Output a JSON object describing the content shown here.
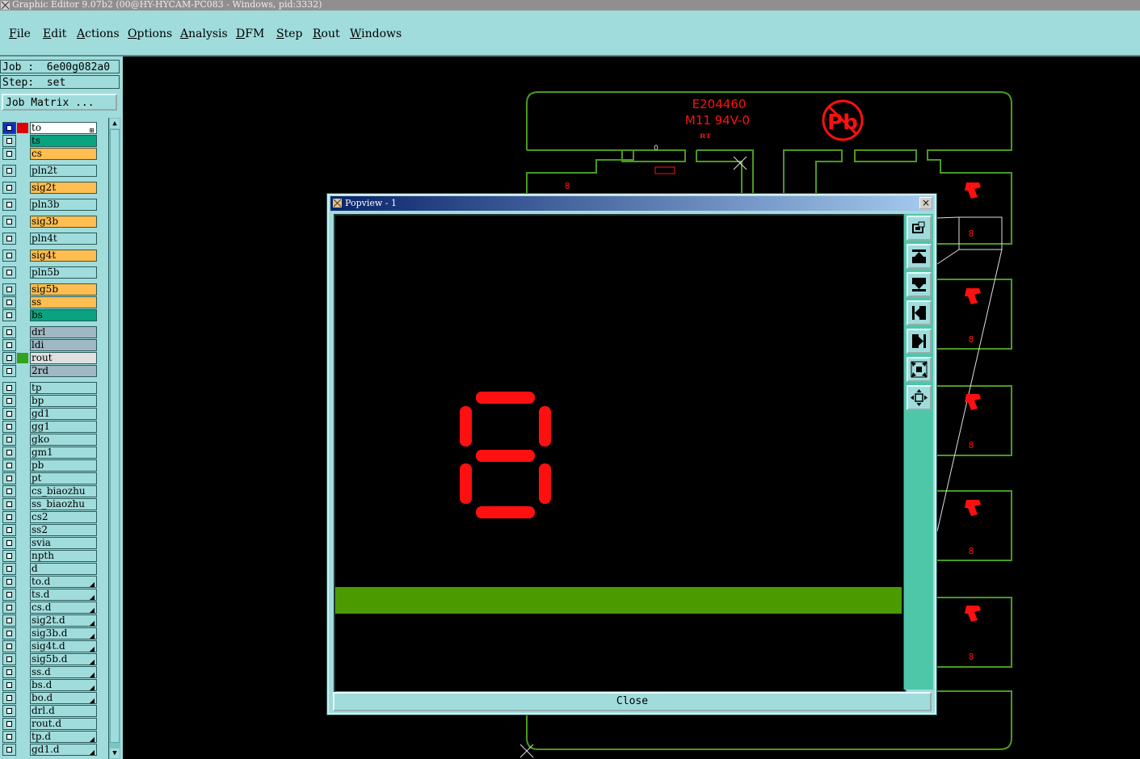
{
  "window": {
    "title": "Graphic Editor 9.07b2 (00@HY-HYCAM-PC083 - Windows, pid:3332)"
  },
  "menu": {
    "items": [
      "File",
      "Edit",
      "Actions",
      "Options",
      "Analysis",
      "DFM",
      "Step",
      "Rout",
      "Windows"
    ]
  },
  "job": {
    "job_label": "Job :  6e00g082a0",
    "step_label": "Step:  set",
    "matrix_button": "Job Matrix ..."
  },
  "layers": [
    {
      "name": "to",
      "color": "#ffffff",
      "swatch": "#e00000",
      "icon": "plus-icon"
    },
    {
      "name": "ts",
      "color": "#0aa37f",
      "swatch": ""
    },
    {
      "name": "cs",
      "color": "#ffbe4f",
      "swatch": ""
    },
    {
      "name": "pln2t",
      "color": "#a0dcdc",
      "swatch": ""
    },
    {
      "name": "sig2t",
      "color": "#ffbe4f",
      "swatch": ""
    },
    {
      "name": "pln3b",
      "color": "#a0dcdc",
      "swatch": ""
    },
    {
      "name": "sig3b",
      "color": "#ffbe4f",
      "swatch": ""
    },
    {
      "name": "pln4t",
      "color": "#a0dcdc",
      "swatch": ""
    },
    {
      "name": "sig4t",
      "color": "#ffbe4f",
      "swatch": ""
    },
    {
      "name": "pln5b",
      "color": "#a0dcdc",
      "swatch": ""
    },
    {
      "name": "sig5b",
      "color": "#ffbe4f",
      "swatch": ""
    },
    {
      "name": "ss",
      "color": "#ffbe4f",
      "swatch": ""
    },
    {
      "name": "bs",
      "color": "#0aa37f",
      "swatch": ""
    },
    {
      "name": "drl",
      "color": "#9fb8c4",
      "swatch": ""
    },
    {
      "name": "ldi",
      "color": "#9fb8c4",
      "swatch": ""
    },
    {
      "name": "rout",
      "color": "#e0e0e0",
      "swatch": "#33a31d"
    },
    {
      "name": "2rd",
      "color": "#9fb8c4",
      "swatch": ""
    },
    {
      "name": "tp",
      "color": "#a0dcdc",
      "swatch": ""
    },
    {
      "name": "bp",
      "color": "#a0dcdc",
      "swatch": ""
    },
    {
      "name": "gd1",
      "color": "#a0dcdc",
      "swatch": ""
    },
    {
      "name": "gg1",
      "color": "#a0dcdc",
      "swatch": ""
    },
    {
      "name": "gko",
      "color": "#a0dcdc",
      "swatch": ""
    },
    {
      "name": "gm1",
      "color": "#a0dcdc",
      "swatch": ""
    },
    {
      "name": "pb",
      "color": "#a0dcdc",
      "swatch": ""
    },
    {
      "name": "pt",
      "color": "#a0dcdc",
      "swatch": ""
    },
    {
      "name": "cs_biaozhu",
      "color": "#a0dcdc",
      "swatch": ""
    },
    {
      "name": "ss_biaozhu",
      "color": "#a0dcdc",
      "swatch": ""
    },
    {
      "name": "cs2",
      "color": "#a0dcdc",
      "swatch": ""
    },
    {
      "name": "ss2",
      "color": "#a0dcdc",
      "swatch": ""
    },
    {
      "name": "svia",
      "color": "#a0dcdc",
      "swatch": ""
    },
    {
      "name": "npth",
      "color": "#a0dcdc",
      "swatch": ""
    },
    {
      "name": "d",
      "color": "#a0dcdc",
      "swatch": ""
    },
    {
      "name": "to.d",
      "color": "#a0dcdc",
      "swatch": "",
      "icon": "drill-icon"
    },
    {
      "name": "ts.d",
      "color": "#a0dcdc",
      "swatch": "",
      "icon": "drill-icon"
    },
    {
      "name": "cs.d",
      "color": "#a0dcdc",
      "swatch": "",
      "icon": "drill-icon"
    },
    {
      "name": "sig2t.d",
      "color": "#a0dcdc",
      "swatch": "",
      "icon": "drill-icon"
    },
    {
      "name": "sig3b.d",
      "color": "#a0dcdc",
      "swatch": "",
      "icon": "drill-icon"
    },
    {
      "name": "sig4t.d",
      "color": "#a0dcdc",
      "swatch": "",
      "icon": "drill-icon"
    },
    {
      "name": "sig5b.d",
      "color": "#a0dcdc",
      "swatch": "",
      "icon": "drill-icon"
    },
    {
      "name": "ss.d",
      "color": "#a0dcdc",
      "swatch": "",
      "icon": "drill-icon"
    },
    {
      "name": "bs.d",
      "color": "#a0dcdc",
      "swatch": "",
      "icon": "drill-icon"
    },
    {
      "name": "bo.d",
      "color": "#a0dcdc",
      "swatch": "",
      "icon": "drill-icon"
    },
    {
      "name": "drl.d",
      "color": "#a0dcdc",
      "swatch": ""
    },
    {
      "name": "rout.d",
      "color": "#a0dcdc",
      "swatch": ""
    },
    {
      "name": "tp.d",
      "color": "#a0dcdc",
      "swatch": "",
      "icon": "drill-icon"
    },
    {
      "name": "gd1.d",
      "color": "#a0dcdc",
      "swatch": "",
      "icon": "drill-icon"
    }
  ],
  "board": {
    "ul_text": "E204460",
    "rating_text": "M11 94V-0",
    "pb_text": "Pb",
    "small_zero": "0",
    "digit": "8",
    "colors": {
      "outline": "#4a9a1f",
      "marking": "#ff1010",
      "trace": "#4a9a00"
    }
  },
  "popview": {
    "title": "Popview - 1",
    "close_x": "×",
    "close_button": "Close",
    "tools": [
      "zoom-window-icon",
      "pan-up-icon",
      "pan-down-icon",
      "pan-left-icon",
      "pan-right-icon",
      "zoom-in-icon",
      "zoom-out-icon"
    ]
  }
}
